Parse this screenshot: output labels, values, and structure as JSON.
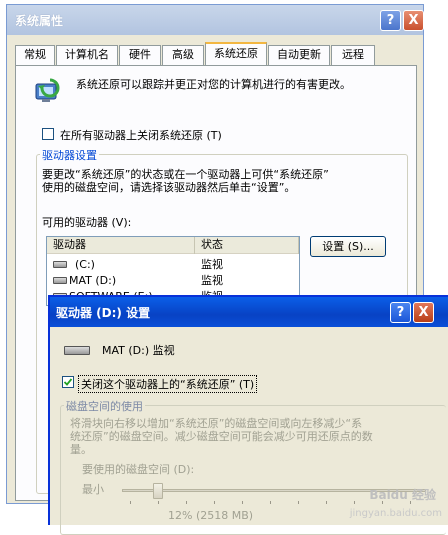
{
  "back_window": {
    "title": "系统属性",
    "help_glyph": "?",
    "close_glyph": "X",
    "tabs": [
      {
        "label": "常规"
      },
      {
        "label": "计算机名"
      },
      {
        "label": "硬件"
      },
      {
        "label": "高级"
      },
      {
        "label": "系统还原",
        "active": true
      },
      {
        "label": "自动更新"
      },
      {
        "label": "远程"
      }
    ],
    "description": "系统还原可以跟踪并更正对您的计算机进行的有害更改。",
    "turn_off_all_label": "在所有驱动器上关闭系统还原 (T)",
    "turn_off_all_checked": false,
    "drive_settings": {
      "title": "驱动器设置",
      "text_line1": "要更改“系统还原”的状态或在一个驱动器上可供“系统还原”",
      "text_line2": "使用的磁盘空间，请选择该驱动器然后单击“设置”。",
      "available_label": "可用的驱动器 (V):",
      "columns": [
        "驱动器",
        "状态"
      ],
      "drives": [
        {
          "name": "(C:)",
          "status": "监视"
        },
        {
          "name": "MAT (D:)",
          "status": "监视"
        },
        {
          "name": "SOFTWARE (E:)",
          "status": "监视"
        }
      ],
      "settings_button": "设置 (S)..."
    }
  },
  "front_window": {
    "title": "驱动器 (D:) 设置",
    "help_glyph": "?",
    "close_glyph": "X",
    "drive_label": "MAT (D:) 监视",
    "turn_off_label": "关闭这个驱动器上的“系统还原” (T)",
    "turn_off_checked": true,
    "disk_space": {
      "title": "磁盘空间的使用",
      "text_line1": "将滑块向右移以增加“系统还原”的磁盘空间或向左移减少“系",
      "text_line2": "统还原”的磁盘空间。减少磁盘空间可能会减少可用还原点的数",
      "text_line3": "量。",
      "usage_label": "要使用的磁盘空间 (D):",
      "min_label": "最小",
      "max_label": "最大",
      "value_text": "12% (2518 MB)",
      "slider_percent": 12
    }
  },
  "watermark": {
    "line1": "Baidu 经验",
    "line2": "jingyan.baidu.com"
  }
}
